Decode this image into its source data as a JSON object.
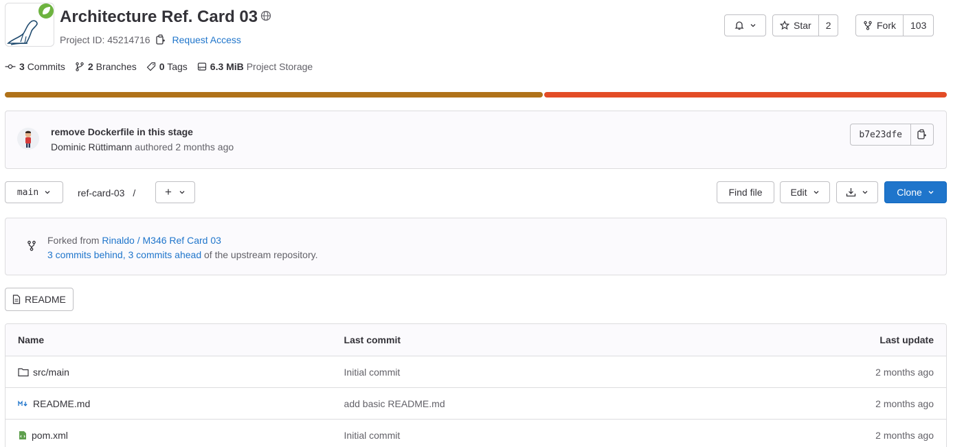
{
  "project": {
    "title": "Architecture Ref. Card 03",
    "visibility_icon": "globe-icon",
    "project_id_label": "Project ID: 45214716",
    "request_access": "Request Access",
    "logo_icons": [
      "spring-leaf-icon",
      "mariadb-seal-icon"
    ]
  },
  "actions": {
    "notification_icon": "bell-icon",
    "star_label": "Star",
    "star_count": "2",
    "fork_label": "Fork",
    "fork_count": "103"
  },
  "stats": [
    {
      "icon": "commit-icon",
      "value": "3",
      "label": "Commits"
    },
    {
      "icon": "branch-icon",
      "value": "2",
      "label": "Branches"
    },
    {
      "icon": "tag-icon",
      "value": "0",
      "label": "Tags"
    },
    {
      "icon": "storage-icon",
      "value": "6.3 MiB",
      "label": "Project Storage"
    }
  ],
  "languages": [
    {
      "share": 0.572,
      "color": "#b07219"
    },
    {
      "share": 0.428,
      "color": "#e34c26"
    }
  ],
  "last_commit": {
    "message": "remove Dockerfile in this stage",
    "author": "Dominic Rüttimann",
    "meta": "authored 2 months ago",
    "sha": "b7e23dfe"
  },
  "toolbar": {
    "branch": "main",
    "path": "ref-card-03",
    "path_sep": "/",
    "add_label": "+",
    "find_file": "Find file",
    "edit": "Edit",
    "clone": "Clone"
  },
  "fork": {
    "prefix": "Forked from ",
    "source": "Rinaldo / M346 Ref Card 03",
    "behind_ahead": "3 commits behind, 3 commits ahead",
    "suffix": " of the upstream repository."
  },
  "readme_button": "README",
  "files": {
    "headers": {
      "name": "Name",
      "last_commit": "Last commit",
      "last_update": "Last update"
    },
    "rows": [
      {
        "icon": "folder-icon",
        "name": "src/main",
        "commit": "Initial commit",
        "updated": "2 months ago"
      },
      {
        "icon": "markdown-icon",
        "name": "README.md",
        "commit": "add basic README.md",
        "updated": "2 months ago"
      },
      {
        "icon": "xml-file-icon",
        "name": "pom.xml",
        "commit": "Initial commit",
        "updated": "2 months ago"
      }
    ]
  },
  "colors": {
    "accent": "#1f75cb",
    "clone_button": "#1f75cb",
    "spring_green": "#6db33f"
  }
}
